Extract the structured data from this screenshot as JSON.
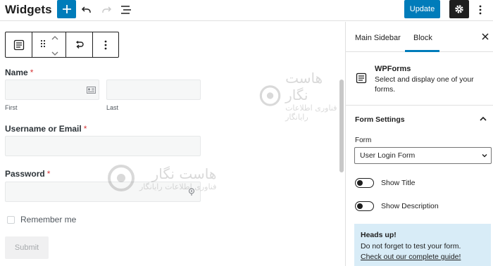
{
  "header": {
    "title": "Widgets",
    "add_icon": "plus-icon",
    "undo_icon": "undo-icon",
    "redo_icon": "redo-icon",
    "list_view_icon": "list-view-icon",
    "update_label": "Update",
    "settings_icon": "gear-icon",
    "more_icon": "vertical-ellipsis-icon",
    "accent_color": "#007cba"
  },
  "block_toolbar": {
    "block_icon": "form-icon",
    "drag_icon": "drag-handle-icon",
    "move_up_icon": "chevron-up-icon",
    "move_down_icon": "chevron-down-icon",
    "transform_icon": "transform-icon",
    "options_icon": "vertical-ellipsis-icon"
  },
  "form": {
    "name_label": "Name",
    "first_sublabel": "First",
    "last_sublabel": "Last",
    "username_label": "Username or Email",
    "password_label": "Password",
    "required_mark": "*",
    "remember_label": "Remember me",
    "submit_label": "Submit"
  },
  "watermark": {
    "main": "هاست نگار",
    "sub": "فناوری اطلاعات رایانگار"
  },
  "sidebar": {
    "tabs": [
      "Main Sidebar",
      "Block"
    ],
    "active_tab": "Block",
    "block_name": "WPForms",
    "block_description": "Select and display one of your forms.",
    "panel_title": "Form Settings",
    "form_label": "Form",
    "form_selected": "User Login Form",
    "toggles": [
      {
        "label": "Show Title",
        "on": false
      },
      {
        "label": "Show Description",
        "on": false
      }
    ],
    "notice": {
      "title": "Heads up!",
      "body": "Do not forget to test your form.",
      "link": "Check out our complete guide!"
    }
  }
}
